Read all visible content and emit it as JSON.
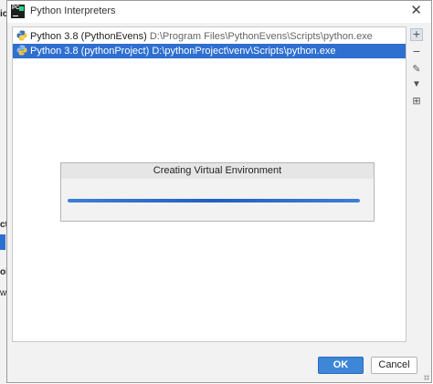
{
  "behind": {
    "fragments": [
      "ic",
      "ct",
      "ol",
      "w"
    ]
  },
  "dialog": {
    "title": "Python Interpreters",
    "close_glyph": "✕"
  },
  "interpreters": [
    {
      "name": "Python 3.8 (PythonEvens)",
      "path": "D:\\Program Files\\PythonEvens\\Scripts\\python.exe",
      "selected": false
    },
    {
      "name": "Python 3.8 (pythonProject)",
      "path": "D:\\pythonProject\\venv\\Scripts\\python.exe",
      "selected": true
    }
  ],
  "toolbar": {
    "add": "+",
    "remove": "−",
    "edit": "✎",
    "filter": "▼",
    "tree": "⊞"
  },
  "progress": {
    "title": "Creating Virtual Environment",
    "percent": 100
  },
  "buttons": {
    "ok": "OK",
    "cancel": "Cancel"
  },
  "colors": {
    "selection": "#2e6fd0",
    "ok_button": "#3e86d8"
  }
}
